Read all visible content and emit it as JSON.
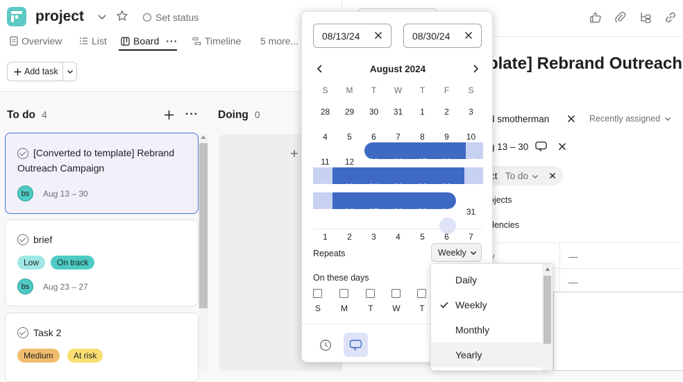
{
  "header": {
    "project_name": "project",
    "set_status_label": "Set status",
    "tabs": [
      {
        "label": "Overview"
      },
      {
        "label": "List"
      },
      {
        "label": "Board"
      },
      {
        "label": "Timeline"
      },
      {
        "label": "5 more..."
      }
    ],
    "add_task_label": "Add task"
  },
  "board": {
    "columns": [
      {
        "title": "To do",
        "count": "4"
      },
      {
        "title": "Doing",
        "count": "0"
      }
    ],
    "cards": [
      {
        "title_line1": "[Converted to template] Rebrand",
        "title_line2": "Outreach Campaign",
        "avatar": "bs",
        "date": "Aug 13 – 30"
      },
      {
        "title_line1": "brief",
        "tags": [
          {
            "label": "Low",
            "color": "#9ee7e3"
          },
          {
            "label": "On track",
            "color": "#4ecbc4"
          }
        ],
        "avatar": "bs",
        "date": "Aug 23 – 27"
      },
      {
        "title_line1": "Task 2",
        "tags": [
          {
            "label": "Medium",
            "color": "#f1bd6c"
          },
          {
            "label": "At risk",
            "color": "#f8df72"
          }
        ]
      }
    ]
  },
  "task_panel": {
    "title_partial": "plate] Rebrand Outreach",
    "assignee_partial": "d smotherman",
    "recently_assigned_label": "Recently assigned",
    "date_partial": "g 13 – 30",
    "project_partial": "ct",
    "section_label": "To do",
    "projects_partial": "ojects",
    "dependencies_partial": "dencies",
    "field_partial": "y",
    "dash1": "—",
    "dash2": "—"
  },
  "date_picker": {
    "start_date": "08/13/24",
    "end_date": "08/30/24",
    "month_label": "August 2024",
    "weekdays": [
      "S",
      "M",
      "T",
      "W",
      "T",
      "F",
      "S"
    ],
    "weeks": [
      [
        "28",
        "29",
        "30",
        "31",
        "1",
        "2",
        "3"
      ],
      [
        "4",
        "5",
        "6",
        "7",
        "8",
        "9",
        "10"
      ],
      [
        "11",
        "12",
        "13",
        "14",
        "15",
        "16",
        "17"
      ],
      [
        "18",
        "19",
        "20",
        "21",
        "22",
        "23",
        "24"
      ],
      [
        "25",
        "26",
        "27",
        "28",
        "29",
        "30",
        "31"
      ],
      [
        "1",
        "2",
        "3",
        "4",
        "5",
        "6",
        "7"
      ]
    ],
    "repeats_label": "Repeats",
    "repeat_value": "Weekly",
    "on_these_days_label": "On these days",
    "day_checkboxes": [
      "S",
      "M",
      "T",
      "W",
      "T"
    ]
  },
  "repeat_dropdown": {
    "options": [
      {
        "label": "Daily"
      },
      {
        "label": "Weekly",
        "selected": true
      },
      {
        "label": "Monthly"
      },
      {
        "label": "Yearly"
      }
    ]
  },
  "colors": {
    "accent": "#3f6ac4",
    "range_light": "#c7d2f3",
    "teal": "#5cc9c3"
  }
}
